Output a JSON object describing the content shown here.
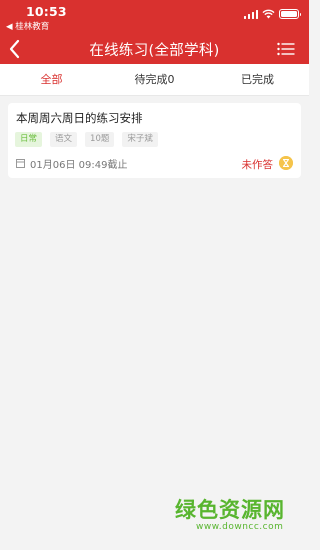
{
  "status_bar": {
    "time": "10:53",
    "back_app": "◀ 桂林教育"
  },
  "nav": {
    "title": "在线练习(全部学科)",
    "back_icon": "chevron-left-icon",
    "menu_icon": "list-menu-icon"
  },
  "tabs": [
    {
      "label": "全部",
      "active": true
    },
    {
      "label": "待完成0",
      "active": false
    },
    {
      "label": "已完成",
      "active": false
    }
  ],
  "assignments": [
    {
      "title": "本周周六周日的练习安排",
      "tags": [
        "日常",
        "语文",
        "10题",
        "宋子斌"
      ],
      "deadline": "01月06日 09:49截止",
      "status": "未作答"
    }
  ],
  "watermark": {
    "text": "绿色资源网",
    "url": "www.downcc.com"
  },
  "colors": {
    "brand": "#d9312f",
    "tag_green": "#6cbf3f",
    "watermark": "#58b52f",
    "hourglass": "#f5c44b"
  }
}
